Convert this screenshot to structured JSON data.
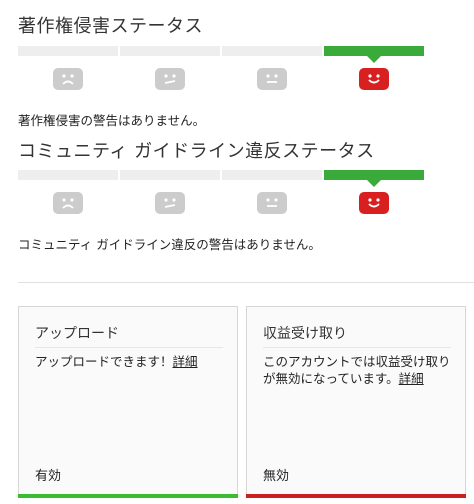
{
  "copyright": {
    "title": "著作権侵害ステータス",
    "message": "著作権侵害の警告はありません。"
  },
  "community": {
    "title": "コミュニティ ガイドライン違反ステータス",
    "message": "コミュニティ ガイドライン違反の警告はありません。"
  },
  "status_level": {
    "segments": 4,
    "active_index": 3
  },
  "faces": [
    "sad-face-icon",
    "meh-face-icon",
    "neutral-face-icon",
    "happy-face-icon"
  ],
  "upload_card": {
    "title": "アップロード",
    "body_text": "アップロードできます！",
    "link_text": "詳細",
    "status": "有効",
    "color": "#3dbb2f"
  },
  "monetization_card": {
    "title": "収益受け取り",
    "body_text": "このアカウントでは収益受け取りが無効になっています。",
    "link_text": "詳細",
    "status": "無効",
    "color": "#cc1f1f"
  },
  "colors": {
    "active_bar": "#3aaa3a",
    "face_inactive": "#cccccc",
    "face_active": "#d92020"
  }
}
